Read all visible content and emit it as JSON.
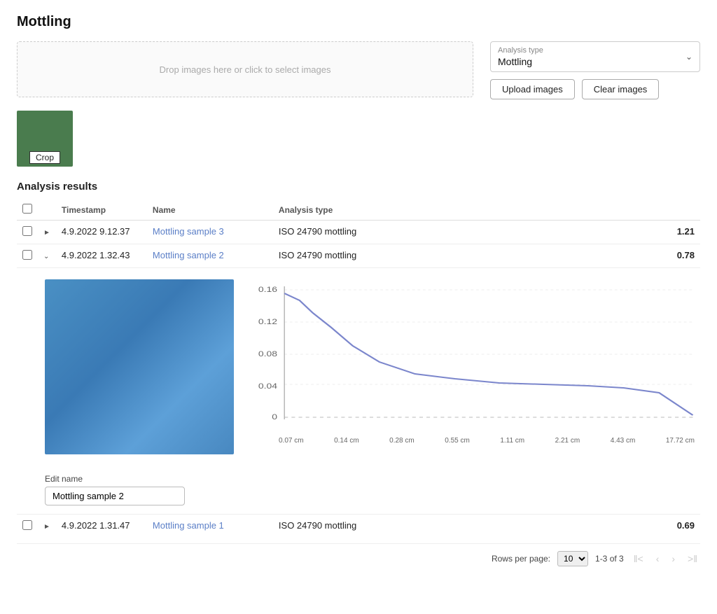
{
  "page": {
    "title": "Mottling"
  },
  "dropzone": {
    "placeholder": "Drop images here or click to select images"
  },
  "analysis_type": {
    "label": "Analysis type",
    "value": "Mottling"
  },
  "buttons": {
    "upload": "Upload images",
    "clear": "Clear images"
  },
  "thumbnail": {
    "crop_label": "Crop"
  },
  "results": {
    "section_title": "Analysis results",
    "columns": {
      "timestamp": "Timestamp",
      "name": "Name",
      "analysis_type": "Analysis type"
    },
    "rows": [
      {
        "id": "row1",
        "timestamp": "4.9.2022 9.12.37",
        "name": "Mottling sample 3",
        "analysis_type": "ISO 24790 mottling",
        "value": "1.21",
        "expanded": false
      },
      {
        "id": "row2",
        "timestamp": "4.9.2022 1.32.43",
        "name": "Mottling sample 2",
        "analysis_type": "ISO 24790 mottling",
        "value": "0.78",
        "expanded": true
      },
      {
        "id": "row3",
        "timestamp": "4.9.2022 1.31.47",
        "name": "Mottling sample 1",
        "analysis_type": "ISO 24790 mottling",
        "value": "0.69",
        "expanded": false
      }
    ]
  },
  "edit_name": {
    "label": "Edit name",
    "value": "Mottling sample 2"
  },
  "chart": {
    "y_labels": [
      "0.16",
      "0.12",
      "0.08",
      "0.04",
      "0"
    ],
    "x_labels": [
      "0.07 cm",
      "0.14 cm",
      "0.28 cm",
      "0.55 cm",
      "1.11 cm",
      "2.21 cm",
      "4.43 cm",
      "17.72 cm"
    ]
  },
  "pagination": {
    "rows_per_page_label": "Rows per page:",
    "rows_per_page_value": "10",
    "range": "1-3 of 3"
  }
}
